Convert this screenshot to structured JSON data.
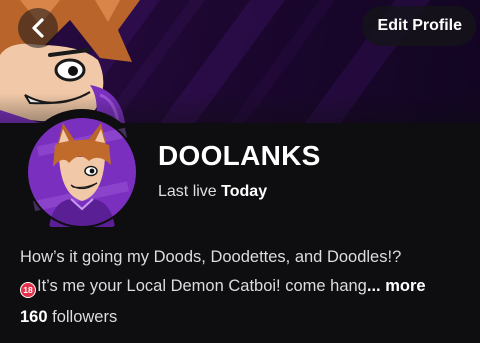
{
  "header": {
    "back_icon": "chevron-left-icon",
    "edit_profile_label": "Edit Profile"
  },
  "banner": {
    "image": "cartoon-catboy-banner",
    "colors": {
      "background": "#1c0730",
      "accent": "#7b2fbf"
    }
  },
  "profile": {
    "avatar_image": "cartoon-catboy-avatar",
    "channel_name": "DOOLANKS",
    "last_live_prefix": "Last live",
    "last_live_value": "Today",
    "bio_line_1": "How’s it going my Doods, Doodettes, and Doodles!?",
    "bio_badge_icon": "no-under-18-icon",
    "bio_badge_text": "18",
    "bio_line_2": "It’s me your Local Demon Catboi! come hang",
    "bio_more": "... more",
    "followers_count": "160",
    "followers_label": "followers"
  },
  "colors": {
    "page_background": "#0e0e10",
    "primary_text": "#efeff1",
    "badge_red": "#e2314a"
  }
}
